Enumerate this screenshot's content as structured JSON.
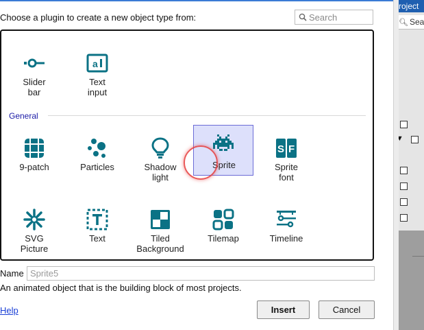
{
  "dialog": {
    "prompt": "Choose a plugin to create a new object type from:",
    "search_placeholder": "Search",
    "section_general": "General",
    "plugins_top": [
      {
        "id": "slider-bar",
        "line1": "Slider",
        "line2": "bar",
        "icon": "slider-bar-icon"
      },
      {
        "id": "text-input",
        "line1": "Text",
        "line2": "input",
        "icon": "text-input-icon"
      }
    ],
    "plugins_general": [
      {
        "id": "9-patch",
        "line1": "9-patch",
        "line2": "",
        "icon": "nine-patch-icon"
      },
      {
        "id": "particles",
        "line1": "Particles",
        "line2": "",
        "icon": "particles-icon"
      },
      {
        "id": "shadow-light",
        "line1": "Shadow",
        "line2": "light",
        "icon": "lightbulb-icon"
      },
      {
        "id": "sprite",
        "line1": "Sprite",
        "line2": "",
        "icon": "space-invader-icon",
        "selected": true
      },
      {
        "id": "sprite-font",
        "line1": "Sprite",
        "line2": "font",
        "icon": "sprite-font-icon"
      },
      {
        "id": "svg-picture",
        "line1": "SVG",
        "line2": "Picture",
        "icon": "asterisk-icon"
      },
      {
        "id": "text",
        "line1": "Text",
        "line2": "",
        "icon": "text-icon"
      },
      {
        "id": "tiled-background",
        "line1": "Tiled",
        "line2": "Background",
        "icon": "tiled-background-icon"
      },
      {
        "id": "tilemap",
        "line1": "Tilemap",
        "line2": "",
        "icon": "tilemap-icon"
      },
      {
        "id": "timeline",
        "line1": "Timeline",
        "line2": "",
        "icon": "timeline-icon"
      }
    ],
    "name_label": "Name",
    "name_placeholder": "Sprite5",
    "description": "An animated object that is the building block of most projects.",
    "help_link": "Help",
    "insert_label": "Insert",
    "cancel_label": "Cancel",
    "accent_color": "#0b7285",
    "selection_color": "#dde0fb"
  },
  "background": {
    "title_fragment": "roject",
    "search_fragment": "Searc"
  }
}
